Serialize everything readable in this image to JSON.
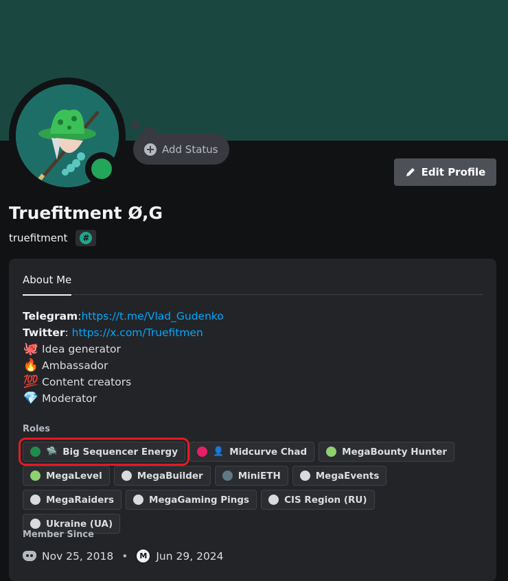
{
  "profile": {
    "display_name": "Truefitment Ø,G",
    "username": "truefitment",
    "badge_symbol": "#",
    "add_status_label": "Add Status",
    "edit_profile_label": "Edit Profile"
  },
  "about": {
    "tab_label": "About Me",
    "telegram_label": "Telegram",
    "telegram_sep": ":",
    "telegram_url": "https://t.me/Vlad_Gudenko",
    "twitter_label": "Twitter",
    "twitter_sep": ": ",
    "twitter_url": "https://x.com/Truefitmen",
    "lines": [
      {
        "emoji": "🐙",
        "text": "Idea generator"
      },
      {
        "emoji": "🔥",
        "text": "Ambassador"
      },
      {
        "emoji": "💯",
        "text": "Content creators"
      },
      {
        "emoji": "💎",
        "text": "Moderator"
      }
    ]
  },
  "roles": {
    "title": "Roles",
    "items": [
      {
        "name": "Big Sequencer Energy",
        "color": "#1f8b4c",
        "emoji": "🛸",
        "highlighted": true
      },
      {
        "name": "Midcurve Chad",
        "color": "#e91e63",
        "emoji": "👤",
        "highlighted": false
      },
      {
        "name": "MegaBounty Hunter",
        "color": "#8fd06f",
        "emoji": "",
        "highlighted": false
      },
      {
        "name": "MegaLevel",
        "color": "#8fd06f",
        "emoji": "",
        "highlighted": false
      },
      {
        "name": "MegaBuilder",
        "color": "#d9dadc",
        "emoji": "",
        "highlighted": false
      },
      {
        "name": "MiniETH",
        "color": "#5f7a87",
        "emoji": "",
        "highlighted": false
      },
      {
        "name": "MegaEvents",
        "color": "#d9dadc",
        "emoji": "",
        "highlighted": false
      },
      {
        "name": "MegaRaiders",
        "color": "#d9dadc",
        "emoji": "",
        "highlighted": false
      },
      {
        "name": "MegaGaming Pings",
        "color": "#d9dadc",
        "emoji": "",
        "highlighted": false
      },
      {
        "name": "CIS Region (RU)",
        "color": "#d9dadc",
        "emoji": "",
        "highlighted": false
      },
      {
        "name": "Ukraine (UA)",
        "color": "#d9dadc",
        "emoji": "",
        "highlighted": false
      }
    ]
  },
  "member_since": {
    "title": "Member Since",
    "discord_date": "Nov 25, 2018",
    "separator": "•",
    "server_icon_letter": "M",
    "server_date": "Jun 29, 2024"
  },
  "colors": {
    "banner": "#1a4840",
    "online_status": "#23a55a",
    "link": "#00a8fc",
    "highlight_outline": "#e01b24"
  }
}
